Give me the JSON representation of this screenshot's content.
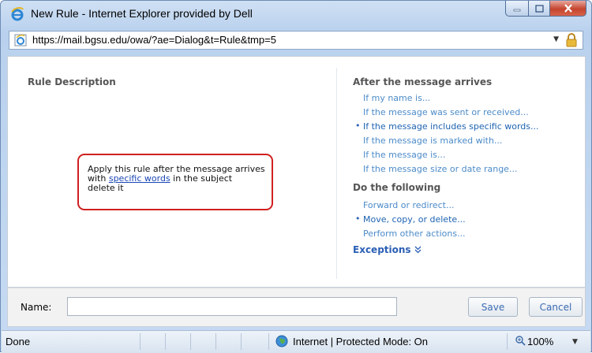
{
  "window": {
    "title": "New Rule - Internet Explorer provided by Dell",
    "address": "https://mail.bgsu.edu/owa/?ae=Dialog&t=Rule&tmp=5"
  },
  "rule_description": {
    "title": "Rule Description",
    "line1": "Apply this rule after the message arrives",
    "line2_prefix": "with ",
    "line2_link": "specific words",
    "line2_suffix": " in the subject",
    "line3": "delete it"
  },
  "after": {
    "title": "After the message arrives",
    "options": [
      {
        "label": "If my name is...",
        "selected": false
      },
      {
        "label": "If the message was sent or received...",
        "selected": false
      },
      {
        "label": "If the message includes specific words...",
        "selected": true
      },
      {
        "label": "If the message is marked with...",
        "selected": false
      },
      {
        "label": "If the message is...",
        "selected": false
      },
      {
        "label": "If the message size or date range...",
        "selected": false
      }
    ]
  },
  "do_following": {
    "title": "Do the following",
    "options": [
      {
        "label": "Forward or redirect...",
        "selected": false
      },
      {
        "label": "Move, copy, or delete...",
        "selected": true
      },
      {
        "label": "Perform other actions...",
        "selected": false
      }
    ]
  },
  "exceptions": {
    "label": "Exceptions",
    "icon": "double-chevron-down-icon"
  },
  "footer": {
    "name_label": "Name:",
    "name_value": "",
    "save_label": "Save",
    "cancel_label": "Cancel"
  },
  "status": {
    "text": "Done",
    "zone": "Internet | Protected Mode: On",
    "zoom": "100%"
  },
  "colors": {
    "link": "#4c8bc9",
    "selected_link": "#1d63b2",
    "highlight_border": "#d02020"
  }
}
